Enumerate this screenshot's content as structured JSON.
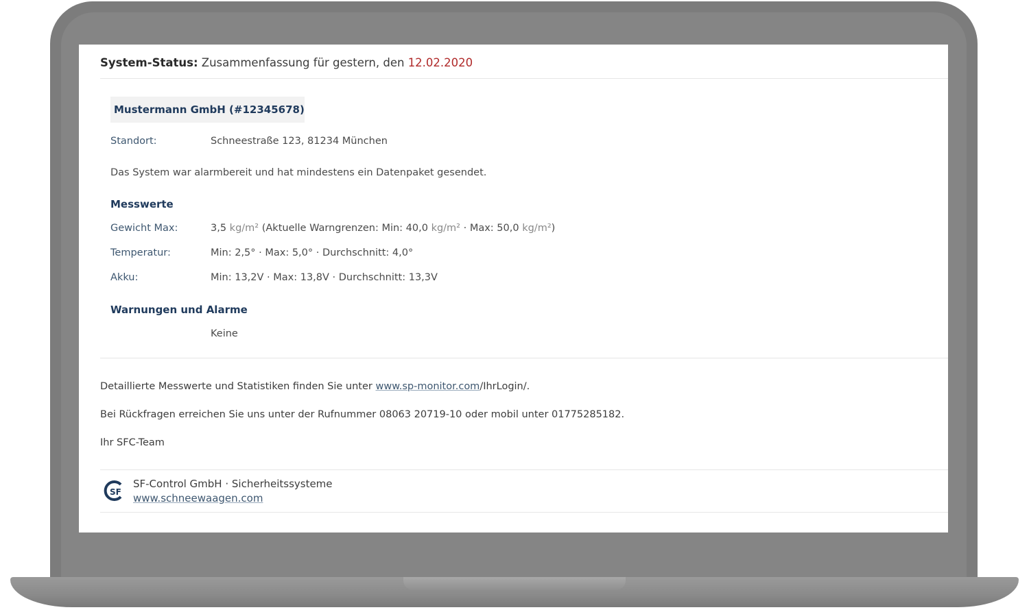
{
  "header": {
    "label": "System-Status:",
    "summary": "Zusammenfassung für gestern, den",
    "date": "12.02.2020"
  },
  "company": {
    "name": "Mustermann GmbH (#12345678)",
    "location_label": "Standort:",
    "location_value": "Schneestraße 123, 81234 München",
    "status_text": "Das System war alarmbereit und hat mindestens ein Datenpaket gesendet."
  },
  "measurements": {
    "heading": "Messwerte",
    "weight": {
      "label": "Gewicht Max:",
      "value": "3,5",
      "unit": "kg/m²",
      "limits_prefix": "(Aktuelle Warngrenzen: Min: 40,0",
      "limits_mid": "· Max: 50,0",
      "limits_suffix": ")"
    },
    "temperature": {
      "label": "Temperatur:",
      "value": "Min: 2,5° · Max: 5,0° · Durchschnitt: 4,0°"
    },
    "battery": {
      "label": "Akku:",
      "value": "Min: 13,2V · Max: 13,8V · Durchschnitt: 13,3V"
    }
  },
  "warnings": {
    "heading": "Warnungen und Alarme",
    "value": "Keine"
  },
  "info": {
    "details_prefix": "Detaillierte Messwerte und Statistiken finden Sie unter",
    "details_link": "www.sp-monitor.com",
    "details_suffix": "/IhrLogin/.",
    "contact": "Bei Rückfragen erreichen Sie uns unter der Rufnummer 08063 20719-10 oder mobil unter 01775285182.",
    "signature": "Ihr SFC-Team"
  },
  "footer": {
    "company": "SF-Control GmbH · Sicherheitssysteme",
    "website": "www.schneewaagen.com",
    "logo_text": "SF"
  },
  "colors": {
    "accent_navy": "#1f3a5c",
    "date_red": "#b02a2a",
    "frame_gray": "#7c7c7c"
  }
}
